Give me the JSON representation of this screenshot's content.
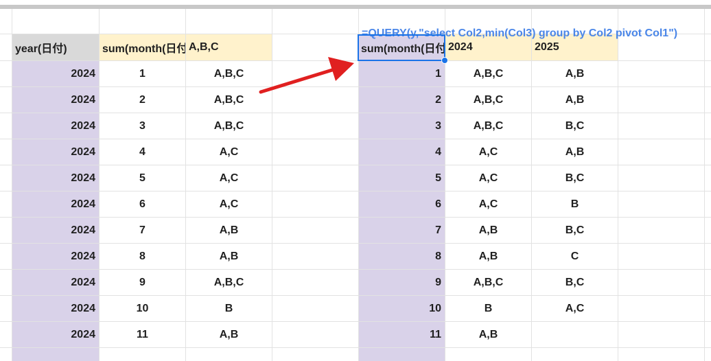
{
  "formula": "=QUERY(y,\"select Col2,min(Col3) group by Col2 pivot Col1\")",
  "left_table": {
    "headers": {
      "year": "year(日付)",
      "month": "sum(month(日付",
      "letters": "A,B,C"
    },
    "rows": [
      {
        "year": "2024",
        "month": "1",
        "letters": "A,B,C"
      },
      {
        "year": "2024",
        "month": "2",
        "letters": "A,B,C"
      },
      {
        "year": "2024",
        "month": "3",
        "letters": "A,B,C"
      },
      {
        "year": "2024",
        "month": "4",
        "letters": "A,C"
      },
      {
        "year": "2024",
        "month": "5",
        "letters": "A,C"
      },
      {
        "year": "2024",
        "month": "6",
        "letters": "A,C"
      },
      {
        "year": "2024",
        "month": "7",
        "letters": "A,B"
      },
      {
        "year": "2024",
        "month": "8",
        "letters": "A,B"
      },
      {
        "year": "2024",
        "month": "9",
        "letters": "A,B,C"
      },
      {
        "year": "2024",
        "month": "10",
        "letters": "B"
      },
      {
        "year": "2024",
        "month": "11",
        "letters": "A,B"
      }
    ]
  },
  "right_table": {
    "headers": {
      "month": "sum(month(日付",
      "y2024": "2024",
      "y2025": "2025"
    },
    "rows": [
      {
        "month": "1",
        "y2024": "A,B,C",
        "y2025": "A,B"
      },
      {
        "month": "2",
        "y2024": "A,B,C",
        "y2025": "A,B"
      },
      {
        "month": "3",
        "y2024": "A,B,C",
        "y2025": "B,C"
      },
      {
        "month": "4",
        "y2024": "A,C",
        "y2025": "A,B"
      },
      {
        "month": "5",
        "y2024": "A,C",
        "y2025": "B,C"
      },
      {
        "month": "6",
        "y2024": "A,C",
        "y2025": "B"
      },
      {
        "month": "7",
        "y2024": "A,B",
        "y2025": "B,C"
      },
      {
        "month": "8",
        "y2024": "A,B",
        "y2025": "C"
      },
      {
        "month": "9",
        "y2024": "A,B,C",
        "y2025": "B,C"
      },
      {
        "month": "10",
        "y2024": "B",
        "y2025": "A,C"
      },
      {
        "month": "11",
        "y2024": "A,B",
        "y2025": ""
      }
    ]
  },
  "colors": {
    "purple": "#d9d2e9",
    "cream": "#fff2cc",
    "header_gray": "#d9d9d9",
    "formula_blue": "#4a86e8",
    "selection_blue": "#1a73e8",
    "arrow_red": "#e02020"
  }
}
